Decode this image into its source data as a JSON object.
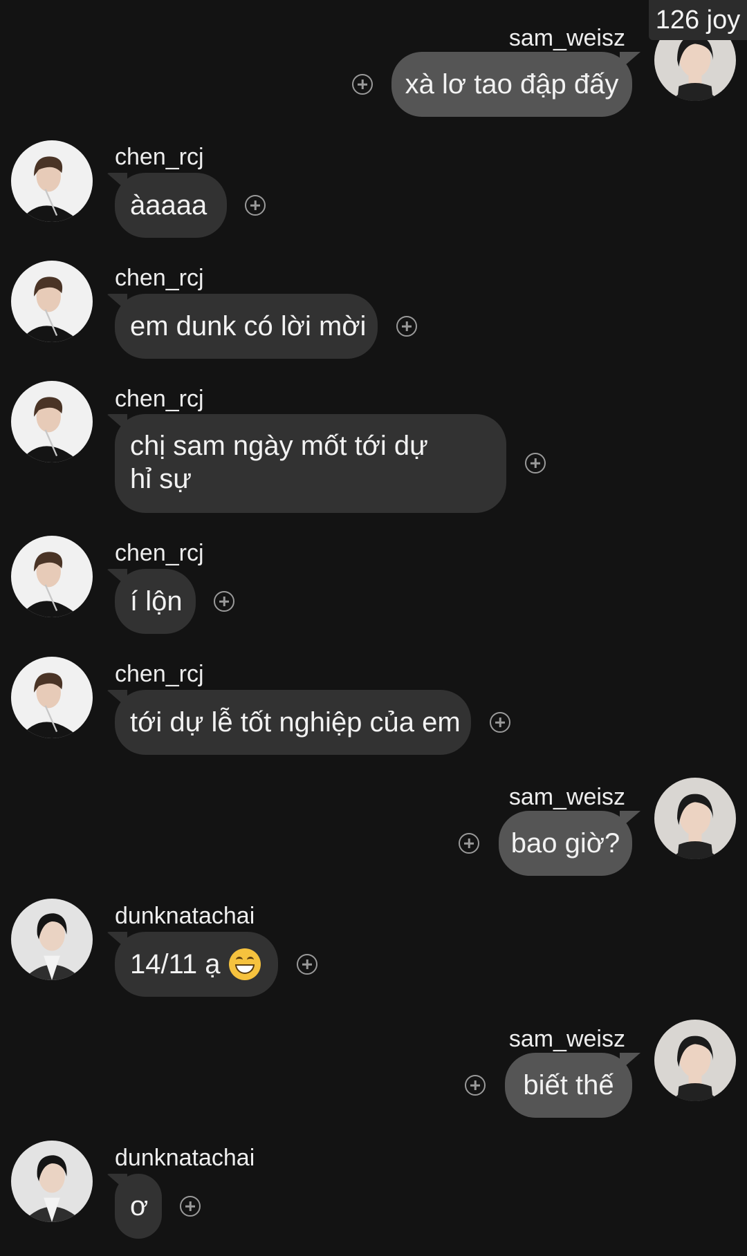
{
  "watermark": "126 joy",
  "messages": [
    {
      "user": "sam_weisz",
      "text": "xà lơ tao đập đấy"
    },
    {
      "user": "chen_rcj",
      "text": "àaaaa"
    },
    {
      "user": "chen_rcj",
      "text": "em dunk có lời mời"
    },
    {
      "user": "chen_rcj",
      "text": "chị sam ngày mốt tới dự hỉ sự"
    },
    {
      "user": "chen_rcj",
      "text": "í lộn"
    },
    {
      "user": "chen_rcj",
      "text": "tới dự lễ tốt nghiệp của em"
    },
    {
      "user": "sam_weisz",
      "text": "bao giờ?"
    },
    {
      "user": "dunknatachai",
      "text": "14/11 ạ"
    },
    {
      "user": "sam_weisz",
      "text": "biết thế"
    },
    {
      "user": "dunknatachai",
      "text": "ơ"
    }
  ],
  "icons": {
    "reaction": "add-reaction-icon",
    "emoji": "grinning-face-emoji"
  },
  "colors": {
    "background": "#131313",
    "incoming_bubble": "#323232",
    "outgoing_bubble": "#555555"
  }
}
